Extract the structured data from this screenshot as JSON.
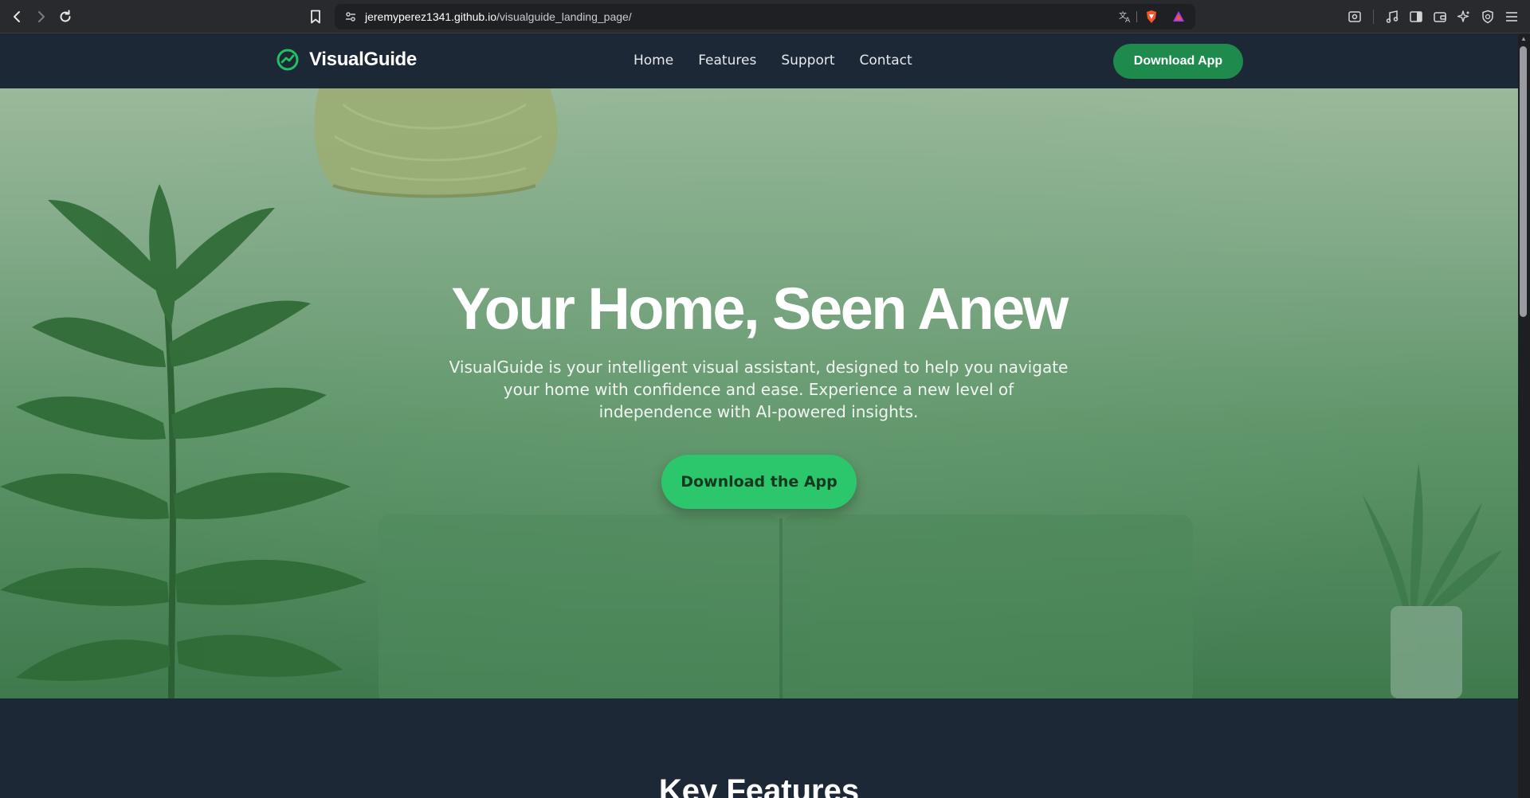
{
  "browser": {
    "url_host": "jeremyperez1341.github.io",
    "url_path": "/visualguide_landing_page/"
  },
  "header": {
    "brand": "VisualGuide",
    "nav": [
      "Home",
      "Features",
      "Support",
      "Contact"
    ],
    "cta_label": "Download App"
  },
  "hero": {
    "title": "Your Home, Seen Anew",
    "description": "VisualGuide is your intelligent visual assistant, designed to help you navigate your home with confidence and ease. Experience a new level of independence with AI-powered insights.",
    "cta_label": "Download the App"
  },
  "features": {
    "heading": "Key Features"
  },
  "colors": {
    "header_bg": "#1c2836",
    "accent": "#1e8a4c",
    "hero_button": "#2cc76d"
  },
  "icons": [
    "back-icon",
    "forward-icon",
    "reload-icon",
    "bookmark-icon",
    "site-settings-icon",
    "translate-icon",
    "brave-shields-icon",
    "brave-rewards-icon",
    "screenshot-icon",
    "media-icon",
    "sidebar-icon",
    "wallet-icon",
    "leo-ai-icon",
    "vpn-icon",
    "menu-icon",
    "logo-icon"
  ]
}
